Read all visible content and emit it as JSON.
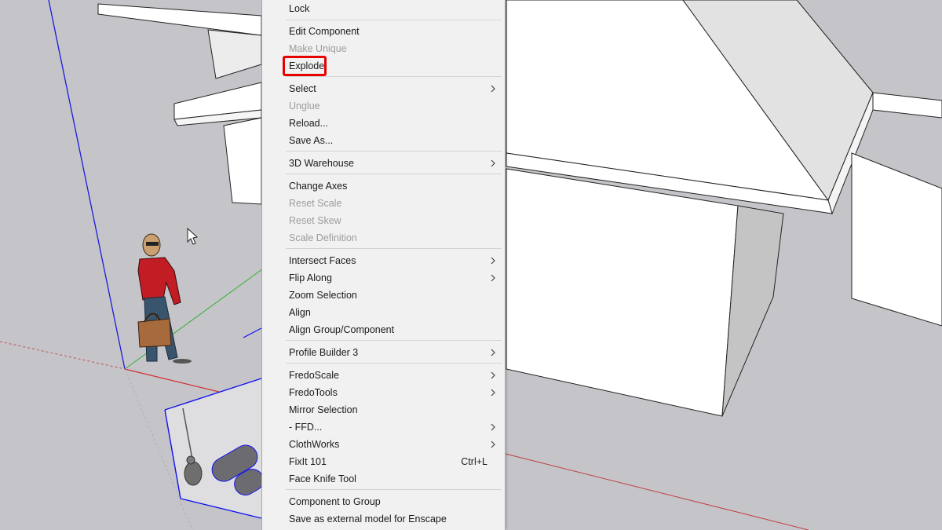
{
  "colors": {
    "viewport_bg": "#c5c5c9",
    "menu_bg": "#f1f1f1",
    "highlight": "#e60000",
    "axis_blue": "#1515e0",
    "axis_red": "#c04040",
    "axis_green": "#30b030",
    "selection_blue": "#1010f0"
  },
  "context_menu": {
    "items": [
      {
        "label": "Lock",
        "enabled": true
      },
      {
        "label": "Edit Component",
        "enabled": true
      },
      {
        "label": "Make Unique",
        "enabled": false
      },
      {
        "label": "Explode",
        "enabled": true,
        "highlighted": true
      },
      {
        "label": "Select",
        "enabled": true,
        "submenu": true
      },
      {
        "label": "Unglue",
        "enabled": false
      },
      {
        "label": "Reload...",
        "enabled": true
      },
      {
        "label": "Save As...",
        "enabled": true
      },
      {
        "label": "3D Warehouse",
        "enabled": true,
        "submenu": true
      },
      {
        "label": "Change Axes",
        "enabled": true
      },
      {
        "label": "Reset Scale",
        "enabled": false
      },
      {
        "label": "Reset Skew",
        "enabled": false
      },
      {
        "label": "Scale Definition",
        "enabled": false
      },
      {
        "label": "Intersect Faces",
        "enabled": true,
        "submenu": true
      },
      {
        "label": "Flip Along",
        "enabled": true,
        "submenu": true
      },
      {
        "label": "Zoom Selection",
        "enabled": true
      },
      {
        "label": "Align",
        "enabled": true
      },
      {
        "label": "Align Group/Component",
        "enabled": true
      },
      {
        "label": "Profile Builder 3",
        "enabled": true,
        "submenu": true
      },
      {
        "label": "FredoScale",
        "enabled": true,
        "submenu": true
      },
      {
        "label": "FredoTools",
        "enabled": true,
        "submenu": true
      },
      {
        "label": "Mirror Selection",
        "enabled": true
      },
      {
        "label": "- FFD...",
        "enabled": true,
        "submenu": true
      },
      {
        "label": "ClothWorks",
        "enabled": true,
        "submenu": true
      },
      {
        "label": "FixIt 101",
        "enabled": true,
        "shortcut": "Ctrl+L"
      },
      {
        "label": "Face Knife Tool",
        "enabled": true
      },
      {
        "label": "Component to Group",
        "enabled": true
      },
      {
        "label": "Save as external model for Enscape",
        "enabled": true
      }
    ]
  },
  "viewport": {
    "icons": [
      "mouse-cursor-icon",
      "chevron-right-icon"
    ]
  }
}
